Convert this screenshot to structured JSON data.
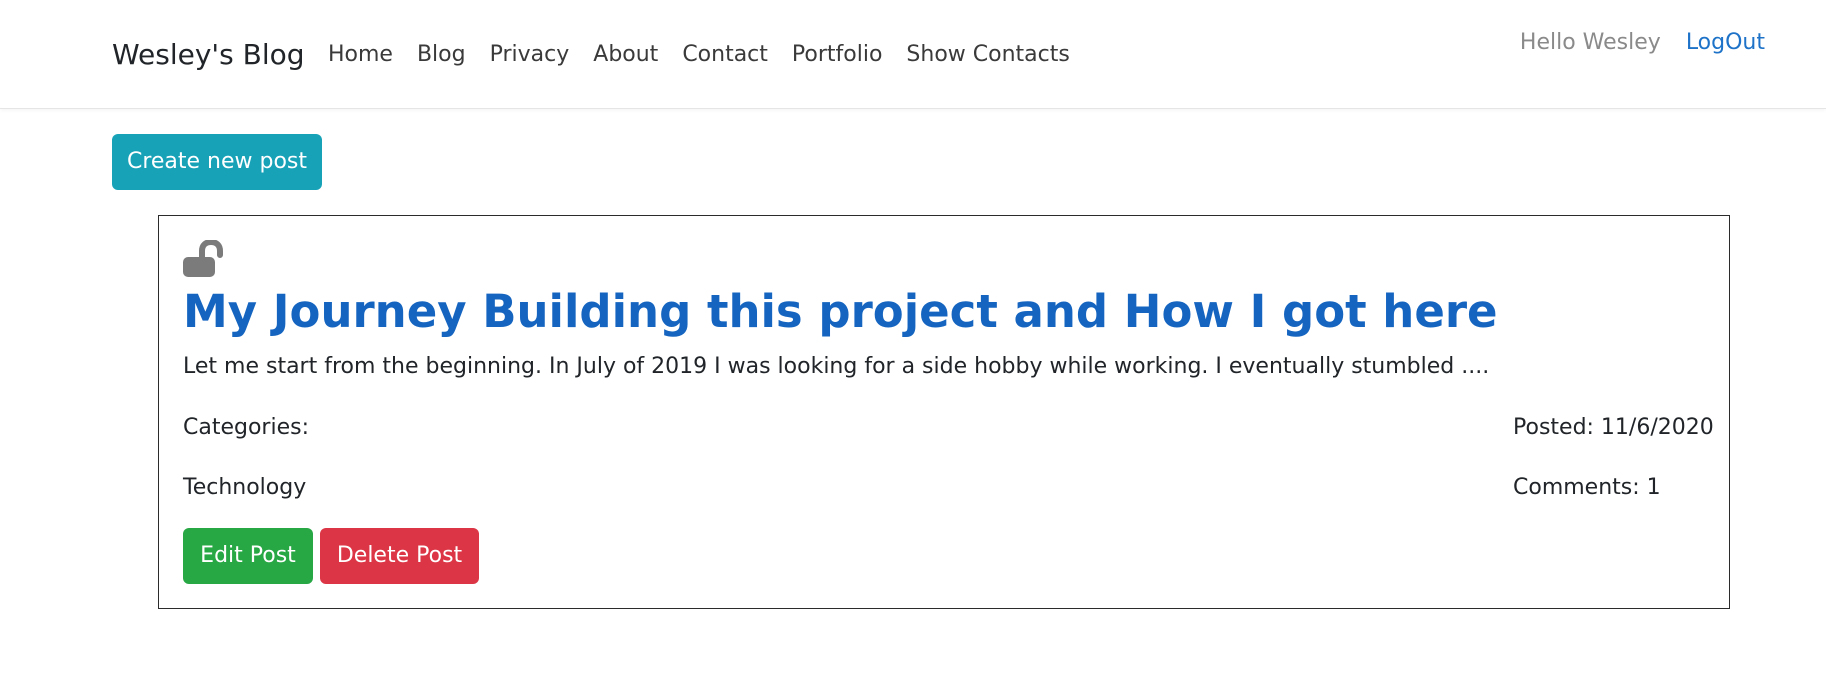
{
  "navbar": {
    "brand": "Wesley's Blog",
    "links": [
      "Home",
      "Blog",
      "Privacy",
      "About",
      "Contact",
      "Portfolio",
      "Show Contacts"
    ],
    "greeting": "Hello Wesley",
    "logout": "LogOut"
  },
  "actions": {
    "create_post": "Create new post"
  },
  "post": {
    "icon": "unlock-icon",
    "title": "My Journey Building this project and How I got here",
    "excerpt": "Let me start from the beginning. In July of 2019 I was looking for a side hobby while working. I eventually stumbled ....",
    "categories_label": "Categories:",
    "category": "Technology",
    "posted": "Posted: 11/6/2020",
    "comments": "Comments: 1",
    "edit_button": "Edit Post",
    "delete_button": "Delete Post"
  },
  "colors": {
    "primary_link": "#1565c0",
    "create_button": "#17a2b8",
    "edit_button": "#28a745",
    "delete_button": "#dc3545"
  }
}
